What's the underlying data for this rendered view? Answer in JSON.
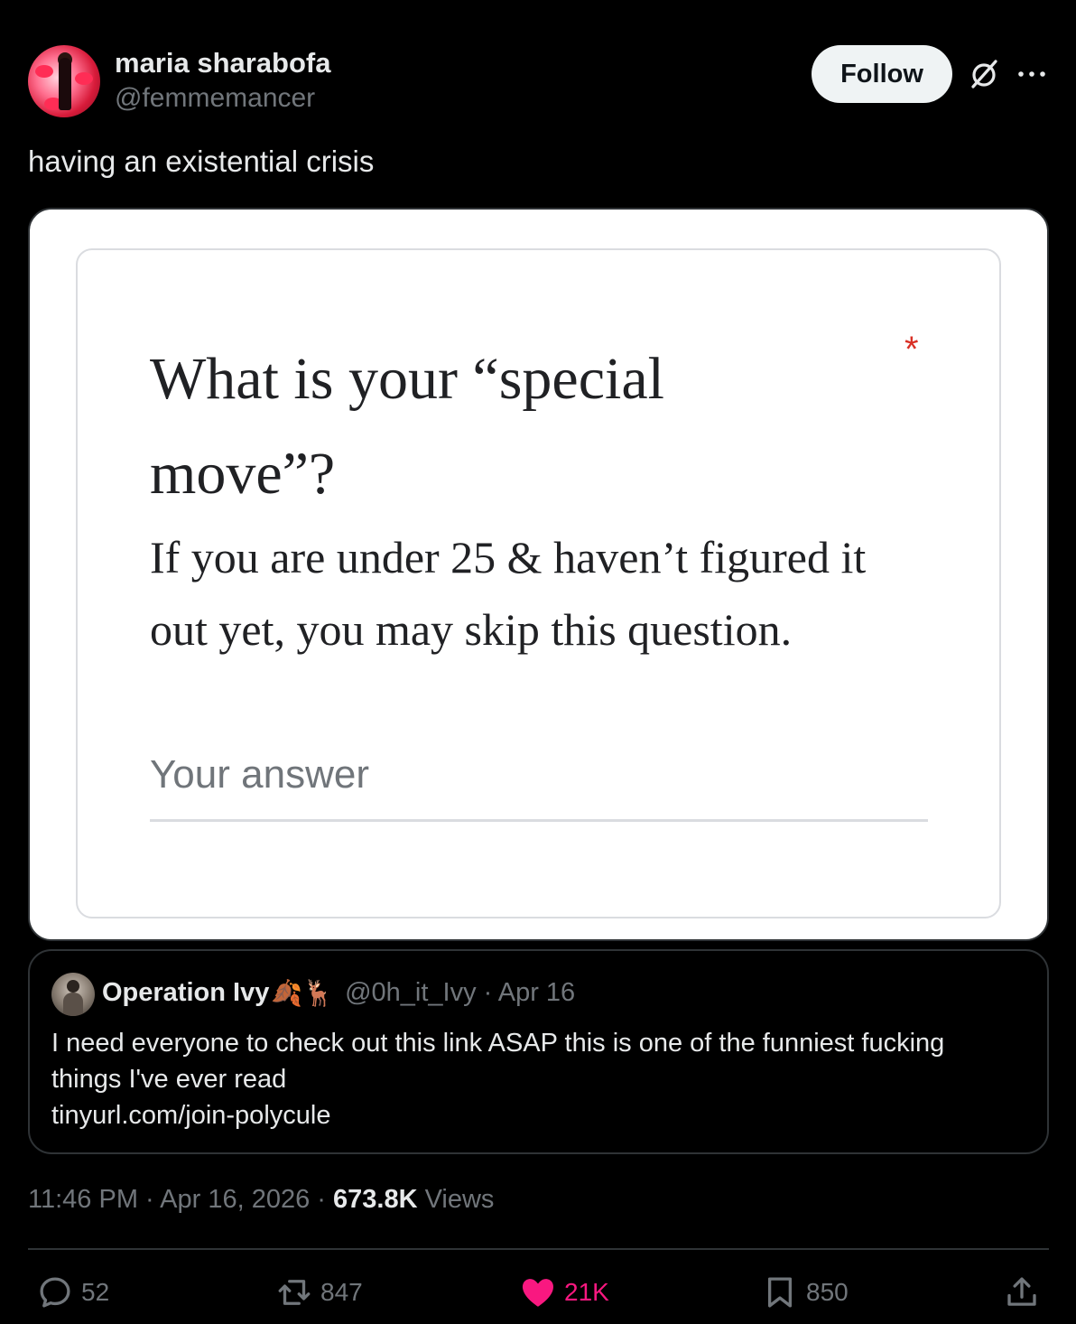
{
  "author": {
    "display_name": "maria sharabofa",
    "handle": "@femmemancer"
  },
  "header_actions": {
    "follow_label": "Follow",
    "grok_icon": "grok-icon",
    "more_icon": "more-icon"
  },
  "tweet": {
    "text": "having an existential crisis"
  },
  "media": {
    "question_line1": "What is your “special",
    "question_line2": "move”?",
    "required_marker": "*",
    "help_line1": "If you are under 25 & haven’t figured it",
    "help_line2": "out yet, you may skip this question.",
    "answer_placeholder": "Your answer"
  },
  "quote": {
    "display_name": "Operation Ivy",
    "name_emojis": "🍂🦌",
    "handle_date": "@0h_it_Ivy · Apr 16",
    "text_line1": "I need everyone to check out this link ASAP this is one of the funniest fucking",
    "text_line2": "things I've ever read",
    "text_line3": "tinyurl.com/join-polycule"
  },
  "meta": {
    "time": "11:46 PM",
    "sep1": " · ",
    "date": "Apr 16, 2026",
    "sep2": " · ",
    "views_count": "673.8K",
    "views_label": " Views"
  },
  "actions": {
    "replies": "52",
    "reposts": "847",
    "likes": "21K",
    "bookmarks": "850"
  },
  "colors": {
    "background": "#000000",
    "text_primary": "#e7e9ea",
    "text_secondary": "#71767b",
    "border": "#2f3336",
    "like_pink": "#f91880",
    "required_red": "#d93025"
  }
}
